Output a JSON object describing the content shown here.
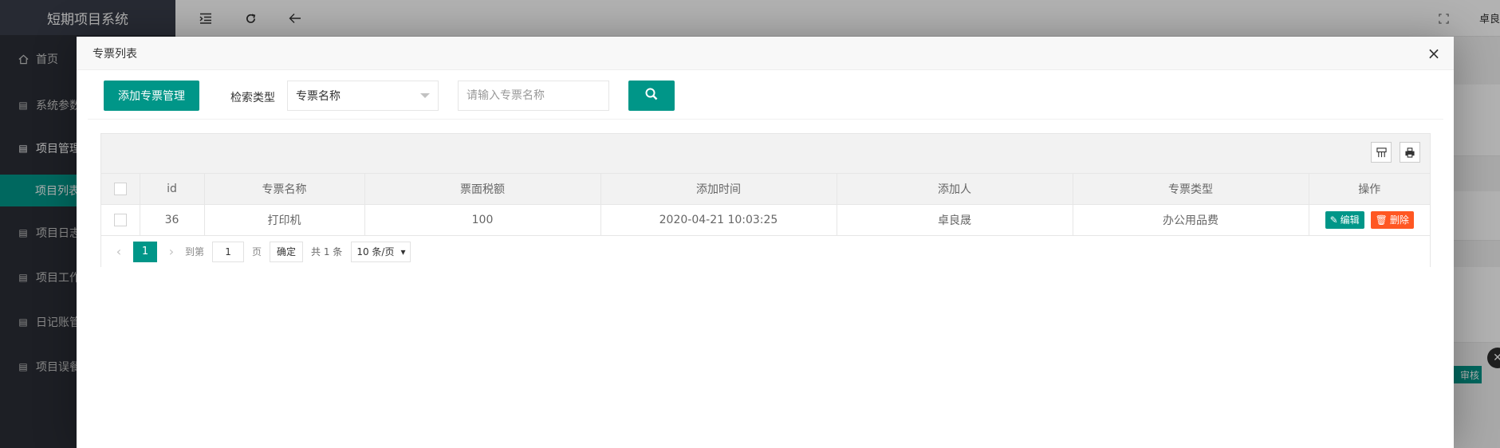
{
  "app": {
    "brand": "短期项目系统",
    "user": "卓良"
  },
  "sidebar": {
    "items": [
      {
        "label": "首页",
        "icon": "home-icon"
      },
      {
        "label": "系统参数",
        "icon": "document-icon"
      },
      {
        "label": "项目管理",
        "icon": "document-icon"
      },
      {
        "label": "项目列表",
        "icon": ""
      },
      {
        "label": "项目日志",
        "icon": "document-icon"
      },
      {
        "label": "项目工作",
        "icon": "document-icon"
      },
      {
        "label": "日记账管",
        "icon": "document-icon"
      },
      {
        "label": "项目误餐",
        "icon": "document-icon"
      }
    ]
  },
  "background": {
    "audit_label": "审核"
  },
  "modal": {
    "title": "专票列表",
    "close": "×",
    "add_button": "添加专票管理",
    "search_type_label": "检索类型",
    "search_type_value": "专票名称",
    "search_placeholder": "请输入专票名称"
  },
  "table": {
    "columns": [
      "id",
      "专票名称",
      "票面税额",
      "添加时间",
      "添加人",
      "专票类型",
      "操作"
    ],
    "rows": [
      {
        "id": "36",
        "name": "打印机",
        "tax": "100",
        "time": "2020-04-21 10:03:25",
        "adder": "卓良晟",
        "type": "办公用品费"
      }
    ],
    "edit_label": "编辑",
    "delete_label": "删除"
  },
  "pager": {
    "current_page": "1",
    "goto_label": "到第",
    "goto_value": "1",
    "page_unit": "页",
    "confirm": "确定",
    "total": "共 1 条",
    "page_size": "10 条/页"
  },
  "colors": {
    "primary": "#009688",
    "danger": "#ff5722",
    "sidebar": "#2a2d35"
  }
}
